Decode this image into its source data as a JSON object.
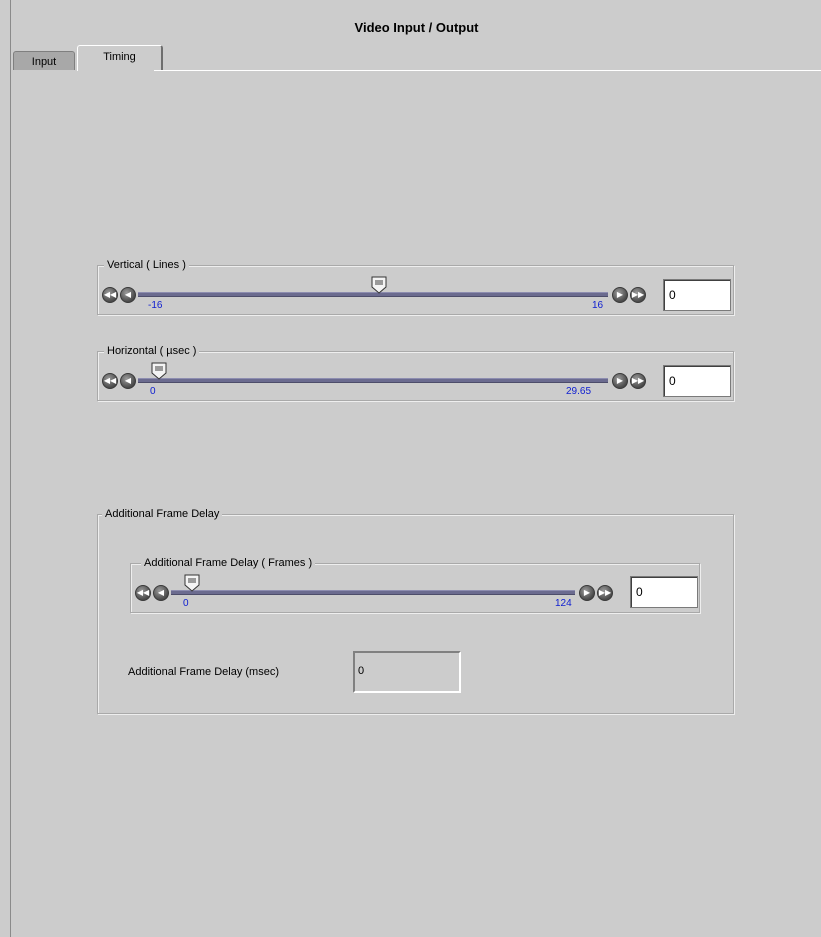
{
  "window": {
    "title": "Video Input / Output"
  },
  "tabs": [
    {
      "label": "Input",
      "active": false
    },
    {
      "label": "Timing",
      "active": true
    }
  ],
  "vertical": {
    "label": "Vertical ( Lines )",
    "min_label": "-16",
    "max_label": "16",
    "min": -16,
    "max": 16,
    "value": "0"
  },
  "horizontal": {
    "label": "Horizontal ( µsec )",
    "min_label": "0",
    "max_label": "29.65",
    "min": 0,
    "max": 29.65,
    "value": "0"
  },
  "frame_delay_group": {
    "label": "Additional Frame Delay",
    "slider": {
      "label": "Additional Frame Delay ( Frames )",
      "min_label": "0",
      "max_label": "124",
      "min": 0,
      "max": 124,
      "value": "0"
    },
    "msec_label": "Additional Frame Delay (msec)",
    "msec_value": "0"
  },
  "icons": {
    "fast_back": "fast-rewind-icon",
    "back": "step-back-icon",
    "forward": "step-forward-icon",
    "fast_forward": "fast-forward-icon",
    "thumb": "slider-thumb-icon"
  },
  "colors": {
    "background": "#cccccc",
    "track": "#6b6b8f",
    "tick_label": "#1020d0"
  }
}
